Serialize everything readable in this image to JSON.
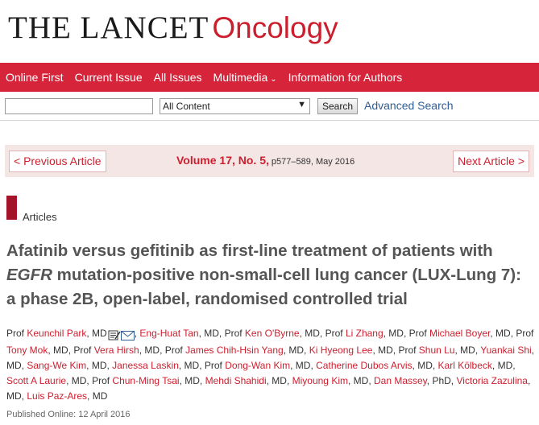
{
  "masthead": {
    "brand": "THE LANCET",
    "journal": "Oncology"
  },
  "nav": {
    "items": [
      "Online First",
      "Current Issue",
      "All Issues",
      "Multimedia",
      "Information for Authors"
    ],
    "multimedia_chevron": "⌄"
  },
  "search": {
    "input_value": "",
    "select_value": "All Content",
    "button_label": "Search",
    "advanced_label": "Advanced Search"
  },
  "issue": {
    "prev_label": "< Previous Article",
    "next_label": "Next Article >",
    "volume": "Volume 17, No. 5,",
    "pages": "p577–589, May 2016"
  },
  "section": {
    "label": "Articles"
  },
  "article": {
    "title_part1": "Afatinib versus gefitinib as first-line treatment of patients with ",
    "title_italic": "EGFR",
    "title_part2": " mutation-positive non-small-cell lung cancer (LUX-Lung 7): a phase 2B, open-label, randomised controlled trial"
  },
  "authors": [
    {
      "prefix": "Prof ",
      "name": "Keunchil Park",
      "suffix": ", MD",
      "icons": [
        "correspondence-icon",
        "email-icon"
      ]
    },
    {
      "prefix": "",
      "name": "Eng-Huat Tan",
      "suffix": ", MD, "
    },
    {
      "prefix": "Prof ",
      "name": "Ken O'Byrne",
      "suffix": ", MD, "
    },
    {
      "prefix": "Prof ",
      "name": "Li Zhang",
      "suffix": ", MD, "
    },
    {
      "prefix": "Prof ",
      "name": "Michael Boyer",
      "suffix": ", MD, "
    },
    {
      "prefix": "Prof ",
      "name": "Tony Mok",
      "suffix": ", MD, "
    },
    {
      "prefix": "Prof ",
      "name": "Vera Hirsh",
      "suffix": ", MD, "
    },
    {
      "prefix": "Prof ",
      "name": "James Chih-Hsin Yang",
      "suffix": ", MD, "
    },
    {
      "prefix": "",
      "name": "Ki Hyeong Lee",
      "suffix": ", MD, "
    },
    {
      "prefix": "Prof ",
      "name": "Shun Lu",
      "suffix": ", MD, "
    },
    {
      "prefix": "",
      "name": "Yuankai Shi",
      "suffix": ", MD, "
    },
    {
      "prefix": "",
      "name": "Sang-We Kim",
      "suffix": ", MD, "
    },
    {
      "prefix": "",
      "name": "Janessa Laskin",
      "suffix": ", MD, "
    },
    {
      "prefix": "Prof ",
      "name": "Dong-Wan Kim",
      "suffix": ", MD, "
    },
    {
      "prefix": "",
      "name": "Catherine Dubos Arvis",
      "suffix": ", MD, "
    },
    {
      "prefix": "",
      "name": "Karl Kölbeck",
      "suffix": ", MD, "
    },
    {
      "prefix": "",
      "name": "Scott A Laurie",
      "suffix": ", MD, "
    },
    {
      "prefix": "Prof ",
      "name": "Chun-Ming Tsai",
      "suffix": ", MD, "
    },
    {
      "prefix": "",
      "name": "Mehdi Shahidi",
      "suffix": ", MD, "
    },
    {
      "prefix": "",
      "name": "Miyoung Kim",
      "suffix": ", MD, "
    },
    {
      "prefix": "",
      "name": "Dan Massey",
      "suffix": ", PhD, "
    },
    {
      "prefix": "",
      "name": "Victoria Zazulina",
      "suffix": ", MD, "
    },
    {
      "prefix": "",
      "name": "Luis Paz-Ares",
      "suffix": ", MD"
    }
  ],
  "published": "Published Online: 12 April 2016",
  "colors": {
    "brand_red": "#cc1f2e",
    "nav_red": "#d6253a",
    "section_marker": "#a3142a",
    "link_blue": "#2f5d95",
    "issue_bar_bg": "#f5e6e6"
  }
}
